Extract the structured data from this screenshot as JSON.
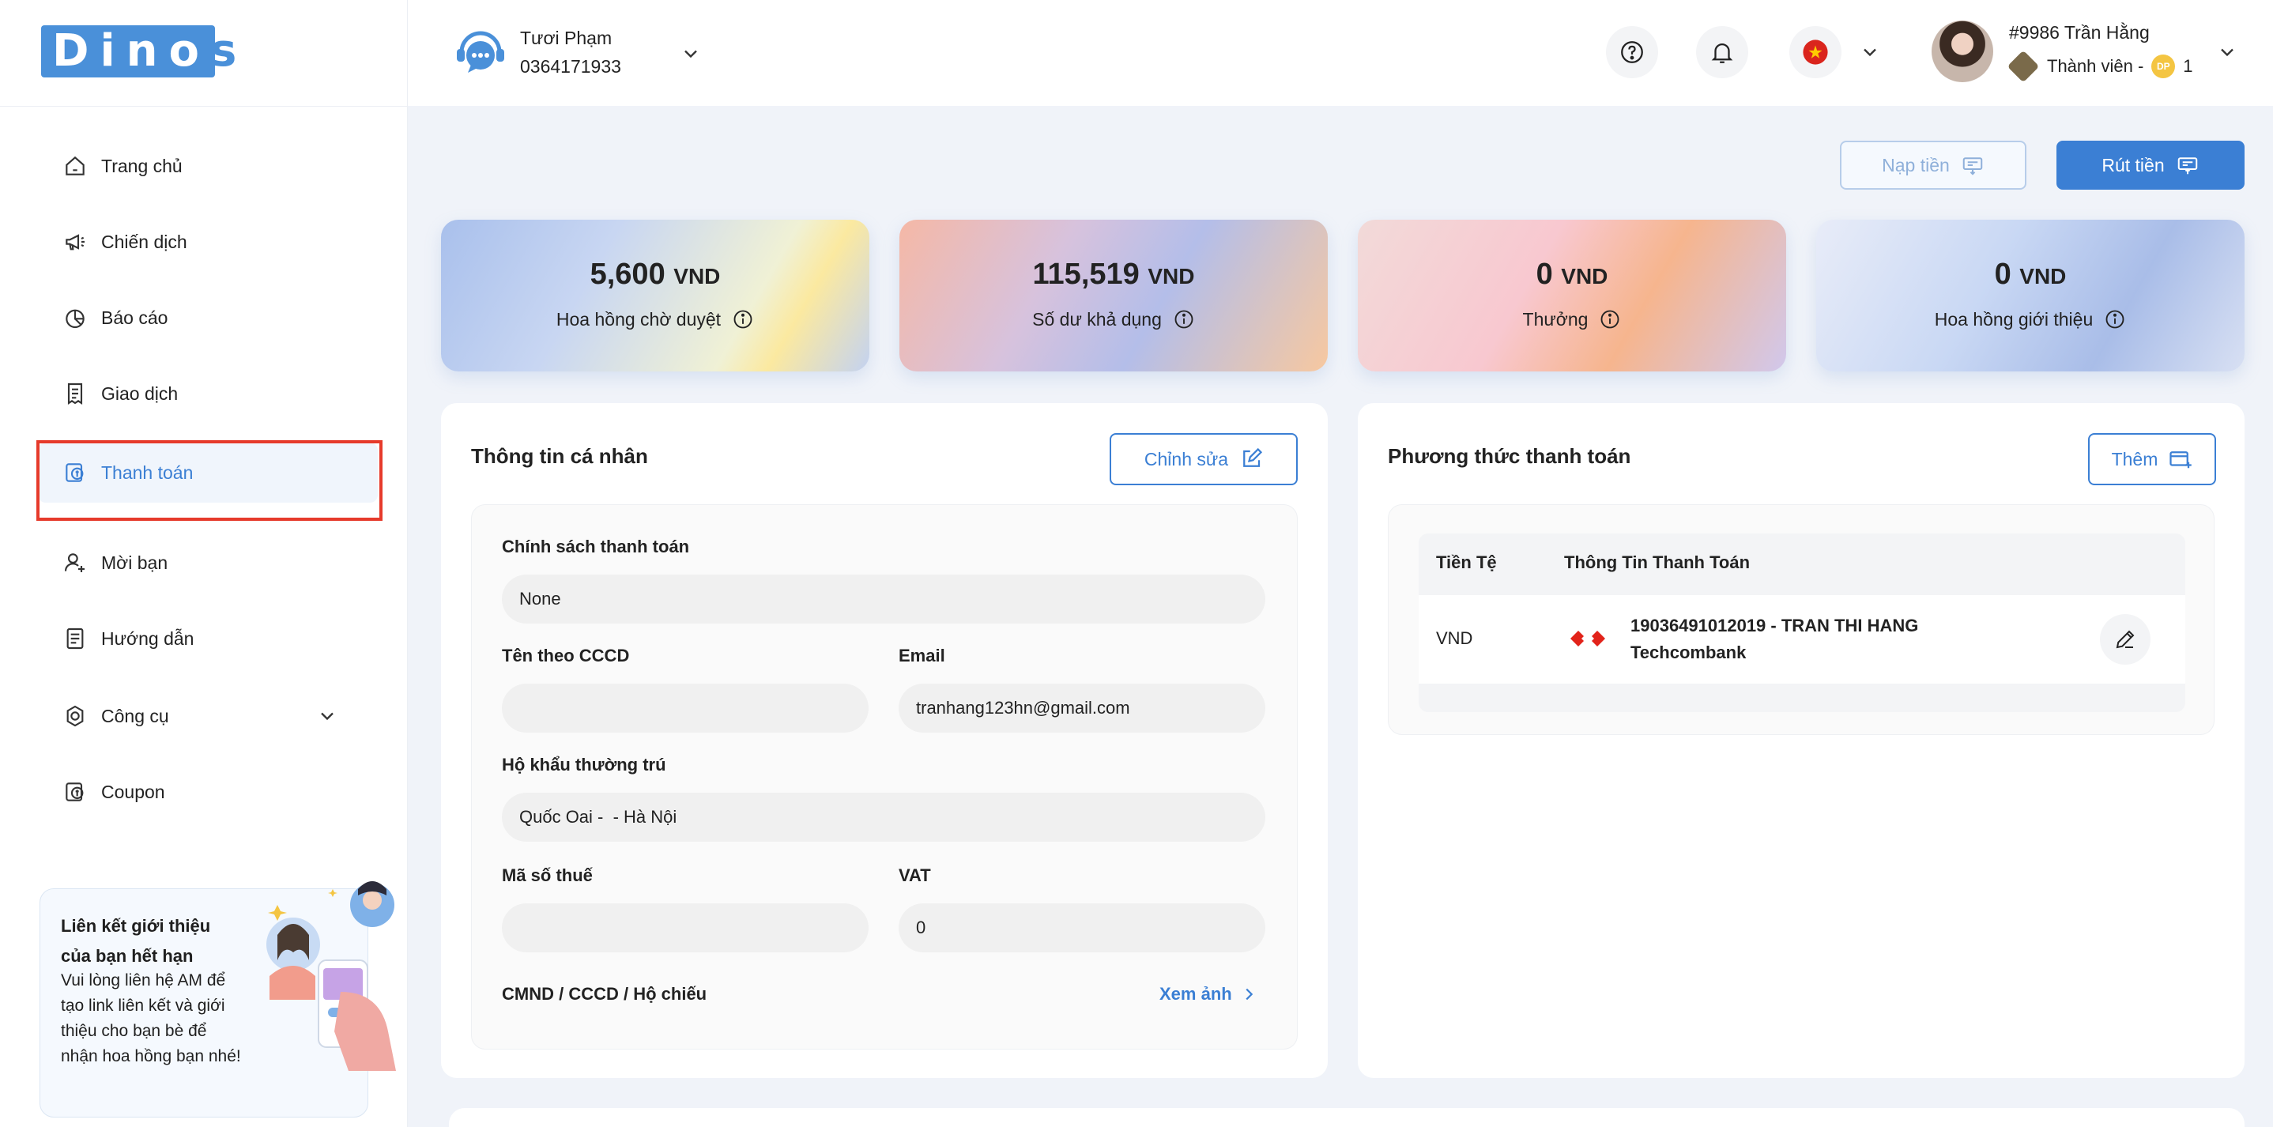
{
  "brand": {
    "logo_text_main": "Dino",
    "logo_text_tail": "s",
    "accent": "#3b7fd4",
    "highlight": "#e63a2b"
  },
  "sidebar": {
    "items": [
      {
        "label": "Trang chủ",
        "icon": "home-icon"
      },
      {
        "label": "Chiến dịch",
        "icon": "megaphone-icon"
      },
      {
        "label": "Báo cáo",
        "icon": "pie-chart-icon"
      },
      {
        "label": "Giao dịch",
        "icon": "receipt-icon"
      },
      {
        "label": "Thanh toán",
        "icon": "payment-icon",
        "active": true
      },
      {
        "label": "Mời bạn",
        "icon": "add-user-icon"
      },
      {
        "label": "Hướng dẫn",
        "icon": "document-icon"
      },
      {
        "label": "Công cụ",
        "icon": "tool-icon",
        "expandable": true
      },
      {
        "label": "Coupon",
        "icon": "coupon-icon"
      }
    ],
    "promo": {
      "title": "Liên kết giới thiệu của bạn hết hạn",
      "text": "Vui lòng liên hệ AM để tạo link liên kết và giới thiệu cho bạn bè để nhận hoa hồng bạn nhé!"
    }
  },
  "header": {
    "support": {
      "name": "Tươi Phạm",
      "phone": "0364171933"
    },
    "user": {
      "name": "#9986 Trần Hằng",
      "rank": "Thành viên -",
      "coin_label": "DP",
      "coin_count": "1"
    }
  },
  "actions": {
    "topup_label": "Nạp tiền",
    "withdraw_label": "Rút tiền"
  },
  "stats": [
    {
      "value": "5,600",
      "unit": "VND",
      "label": "Hoa hồng chờ duyệt"
    },
    {
      "value": "115,519",
      "unit": "VND",
      "label": "Số dư khả dụng"
    },
    {
      "value": "0",
      "unit": "VND",
      "label": "Thưởng"
    },
    {
      "value": "0",
      "unit": "VND",
      "label": "Hoa hồng giới thiệu"
    }
  ],
  "personal": {
    "title": "Thông tin cá nhân",
    "edit_label": "Chỉnh sửa",
    "policy_label": "Chính sách thanh toán",
    "policy_value": "None",
    "name_label": "Tên theo CCCD",
    "name_value": "",
    "email_label": "Email",
    "email_value": "tranhang123hn@gmail.com",
    "address_label": "Hộ khẩu thường trú",
    "address_value": "Quốc Oai -  - Hà Nội",
    "tax_label": "Mã số thuế",
    "tax_value": "",
    "vat_label": "VAT",
    "vat_value": "0",
    "id_label": "CMND / CCCD / Hộ chiếu",
    "view_label": "Xem ảnh"
  },
  "payment": {
    "title": "Phương thức thanh toán",
    "add_label": "Thêm",
    "col_currency": "Tiền Tệ",
    "col_info": "Thông Tin Thanh Toán",
    "rows": [
      {
        "currency": "VND",
        "account": "19036491012019 - TRAN THI HANG",
        "bank": "Techcombank"
      }
    ]
  }
}
